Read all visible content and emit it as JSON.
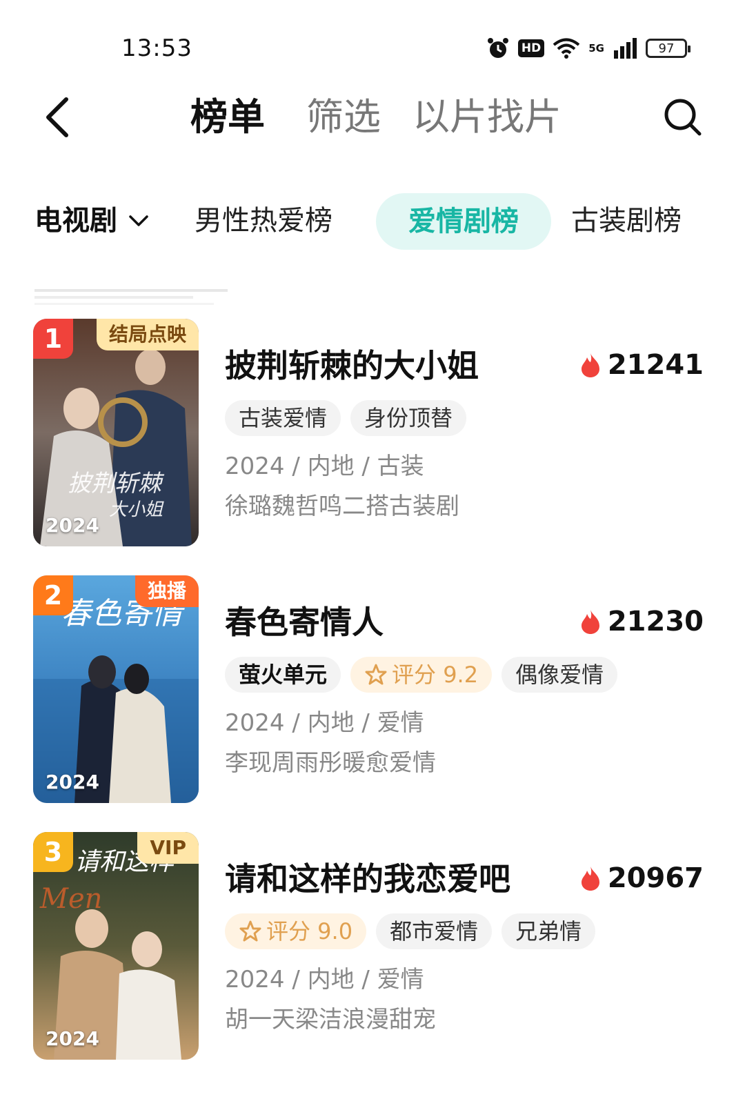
{
  "status_bar": {
    "time": "13:53",
    "hd": "HD",
    "network": "5G",
    "battery": "97"
  },
  "header": {
    "tabs": [
      "榜单",
      "筛选",
      "以片找片"
    ],
    "active_tab": "榜单"
  },
  "categories": {
    "dropdown_label": "电视剧",
    "items": [
      "男性热爱榜",
      "爱情剧榜",
      "古装剧榜"
    ],
    "active": "爱情剧榜"
  },
  "list": [
    {
      "rank": "1",
      "badge": "结局点映",
      "year": "2024",
      "title": "披荆斩棘的大小姐",
      "heat": "21241",
      "tags": [
        "古装爱情",
        "身份顶替"
      ],
      "meta": "2024 / 内地 / 古装",
      "desc": "徐璐魏哲鸣二搭古装剧",
      "poster_text": "披荆斩棘的大小姐"
    },
    {
      "rank": "2",
      "badge": "独播",
      "year": "2024",
      "title": "春色寄情人",
      "heat": "21230",
      "tags": [
        "萤火单元",
        "评分 9.2",
        "偶像爱情"
      ],
      "meta": "2024 / 内地 / 爱情",
      "desc": "李现周雨彤暖愈爱情",
      "poster_text": "春色寄情人"
    },
    {
      "rank": "3",
      "badge": "VIP",
      "year": "2024",
      "title": "请和这样的我恋爱吧",
      "heat": "20967",
      "tags": [
        "评分 9.0",
        "都市爱情",
        "兄弟情"
      ],
      "meta": "2024 / 内地 / 爱情",
      "desc": "胡一天梁洁浪漫甜宠",
      "poster_text": "请和这样的我恋爱吧"
    }
  ],
  "colors": {
    "accent": "#18b6a4",
    "accent_bg": "#e2f7f4",
    "heat": "#f0423b",
    "rank1": "#f0423b",
    "rank2": "#ff7a1a",
    "rank3": "#f7b51e",
    "badge1_bg": "#ffe6a8",
    "badge2_bg": "#ff6a2b",
    "badge3_bg": "#ffe6a8"
  },
  "icons": [
    "back-icon",
    "search-icon",
    "alarm-icon",
    "wifi-icon",
    "signal-icon",
    "chevron-down-icon",
    "fire-icon",
    "star-icon"
  ]
}
